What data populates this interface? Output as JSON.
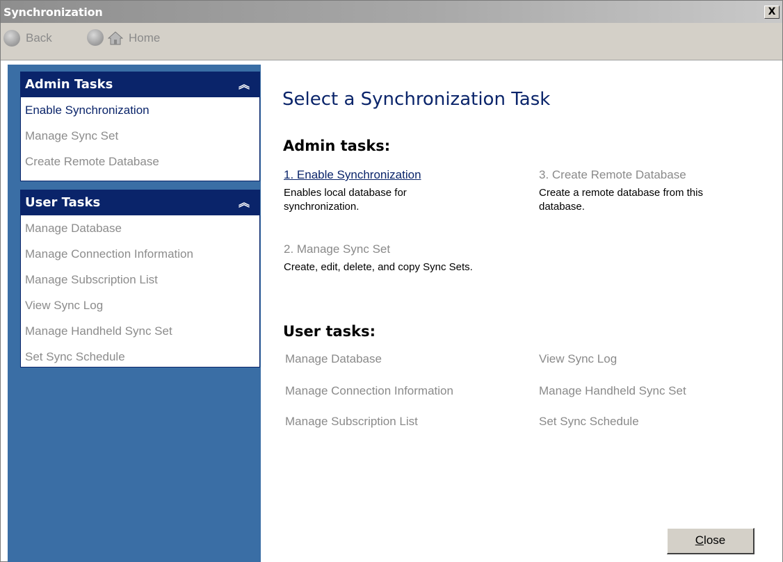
{
  "window": {
    "title": "Synchronization",
    "close_glyph": "X"
  },
  "navbar": {
    "back_label": "Back",
    "home_label": "Home"
  },
  "sidebar": {
    "admin": {
      "header": "Admin Tasks",
      "chevron": "»",
      "items": [
        {
          "label": "Enable Synchronization"
        },
        {
          "label": "Manage Sync Set"
        },
        {
          "label": "Create Remote Database"
        }
      ]
    },
    "user": {
      "header": "User Tasks",
      "chevron": "»",
      "items": [
        {
          "label": "Manage Database"
        },
        {
          "label": "Manage Connection Information"
        },
        {
          "label": "Manage Subscription List"
        },
        {
          "label": "View Sync Log"
        },
        {
          "label": "Manage Handheld Sync Set"
        },
        {
          "label": "Set Sync Schedule"
        }
      ]
    }
  },
  "main": {
    "title": "Select a Synchronization Task",
    "admin_section": "Admin tasks:",
    "admin_tasks": [
      {
        "label": "1. Enable Synchronization",
        "desc": "Enables local database for synchronization."
      },
      {
        "label": "3. Create Remote Database",
        "desc": "Create a remote database from this database."
      },
      {
        "label": "2. Manage Sync Set",
        "desc": "Create, edit, delete, and copy Sync Sets."
      }
    ],
    "user_section": "User tasks:",
    "user_tasks": [
      "Manage Database",
      "View Sync Log",
      "Manage Connection Information",
      "Manage Handheld Sync Set",
      "Manage Subscription List",
      "Set Sync Schedule"
    ],
    "close_button": {
      "mnemonic": "C",
      "rest": "lose"
    }
  },
  "colors": {
    "sidebar_bg": "#3a6ea5",
    "header_bg": "#0a246a",
    "accent_text": "#0a246a",
    "disabled_text": "#8a8a8a"
  }
}
